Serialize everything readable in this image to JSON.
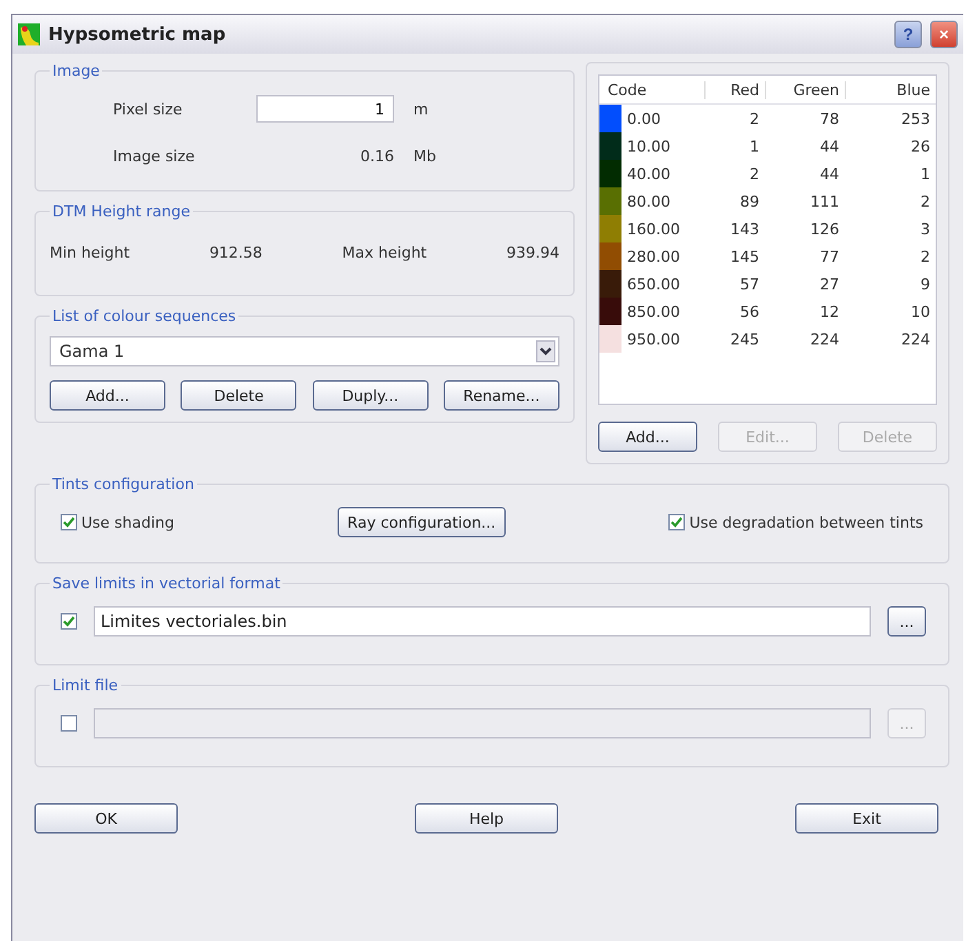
{
  "window": {
    "title": "Hypsometric map",
    "help_button": "?",
    "close_button": "×"
  },
  "image": {
    "title": "Image",
    "pixel_size_label": "Pixel size",
    "pixel_size": "1",
    "pixel_unit": "m",
    "image_size_label": "Image size",
    "image_size": "0.16",
    "image_unit": "Mb"
  },
  "height_range": {
    "title": "DTM Height range",
    "min_label": "Min height",
    "min": "912.58",
    "max_label": "Max height",
    "max": "939.94"
  },
  "colour_sequences": {
    "title": "List of colour sequences",
    "selected": "Gama 1",
    "buttons": [
      {
        "label": "Add...",
        "disabled": false
      },
      {
        "label": "Delete",
        "disabled": false
      },
      {
        "label": "Duply...",
        "disabled": false
      },
      {
        "label": "Rename...",
        "disabled": false
      }
    ]
  },
  "table": {
    "columns": [
      "Code",
      "Red",
      "Green",
      "Blue"
    ],
    "rows": [
      {
        "color": "#024efd",
        "cells": [
          "0.00",
          "2",
          "78",
          "253"
        ]
      },
      {
        "color": "#012c1a",
        "cells": [
          "10.00",
          "1",
          "44",
          "26"
        ]
      },
      {
        "color": "#022c01",
        "cells": [
          "40.00",
          "2",
          "44",
          "1"
        ]
      },
      {
        "color": "#596f02",
        "cells": [
          "80.00",
          "89",
          "111",
          "2"
        ]
      },
      {
        "color": "#8f7e03",
        "cells": [
          "160.00",
          "143",
          "126",
          "3"
        ]
      },
      {
        "color": "#914d02",
        "cells": [
          "280.00",
          "145",
          "77",
          "2"
        ]
      },
      {
        "color": "#391b09",
        "cells": [
          "650.00",
          "57",
          "27",
          "9"
        ]
      },
      {
        "color": "#380c0a",
        "cells": [
          "850.00",
          "56",
          "12",
          "10"
        ]
      },
      {
        "color": "#f5e0e0",
        "cells": [
          "950.00",
          "245",
          "224",
          "224"
        ]
      }
    ],
    "buttons": [
      {
        "label": "Add...",
        "disabled": false
      },
      {
        "label": "Edit...",
        "disabled": true
      },
      {
        "label": "Delete",
        "disabled": true
      }
    ]
  },
  "tints": {
    "title": "Tints configuration",
    "use_shading": {
      "label": "Use shading",
      "checked": true
    },
    "ray_button": "Ray configuration...",
    "degradation": {
      "label": "Use degradation between tints",
      "checked": true
    }
  },
  "save_limits": {
    "title": "Save limits in vectorial format",
    "checked": true,
    "disabled": false,
    "value": "Limites vectoriales.bin",
    "browse": "..."
  },
  "limit_file": {
    "title": "Limit file",
    "checked": false,
    "disabled": true,
    "browse": "..."
  },
  "buttons": [
    "OK",
    "Help",
    "Exit"
  ]
}
